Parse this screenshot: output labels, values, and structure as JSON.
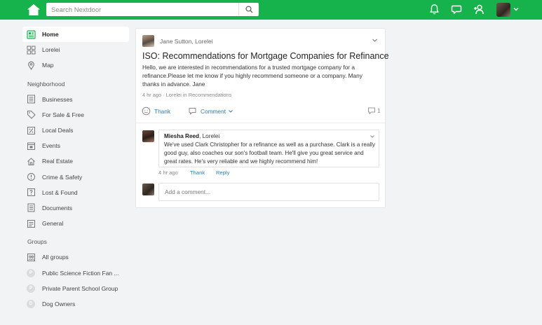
{
  "header": {
    "search_placeholder": "Search Nextdoor",
    "icons": [
      "home-icon",
      "search-icon",
      "bell-icon",
      "chat-icon",
      "add-neighbor-icon",
      "chevron-down-icon"
    ],
    "brand_color": "#16b24b"
  },
  "sidebar": {
    "home": "Home",
    "lorelei": "Lorelei",
    "map": "Map",
    "neighborhood_heading": "Neighborhood",
    "neighborhood": [
      "Businesses",
      "For Sale & Free",
      "Local Deals",
      "Events",
      "Real Estate",
      "Crime & Safety",
      "Lost & Found",
      "Documents",
      "General"
    ],
    "groups_heading": "Groups",
    "all_groups": "All groups",
    "groups": [
      "Public Science Fiction Fan ...",
      "Private Parent School Group",
      "Dog Owners"
    ]
  },
  "post": {
    "author": "Jane Sutton, Lorelei",
    "title": "ISO: Recommendations for Mortgage Companies for Refinance",
    "body": "Hello, we are interested in recommendations for a trusted mortgage company for a refinance.Please let me know if you highly recommend someone or a company. Many thanks in advance. Jane",
    "meta": "4 hr ago · Lorelei in Recommendations",
    "thank_label": "Thank",
    "comment_label": "Comment",
    "comment_count": "1",
    "link_color": "#2a7db8"
  },
  "reply": {
    "author_name": "Miesha Reed",
    "author_neighborhood": ", Lorelei",
    "text": "We've used Clark Christopher for a refinance as well as a purchase. Clark is a really good guy, also coaches our son's football team. He'll give you great service and great rates. He's very reliable and we highly recommend him!",
    "time": "4 hr ago",
    "thank_label": "Thank",
    "reply_label": "Reply"
  },
  "comment": {
    "placeholder": "Add a comment..."
  }
}
